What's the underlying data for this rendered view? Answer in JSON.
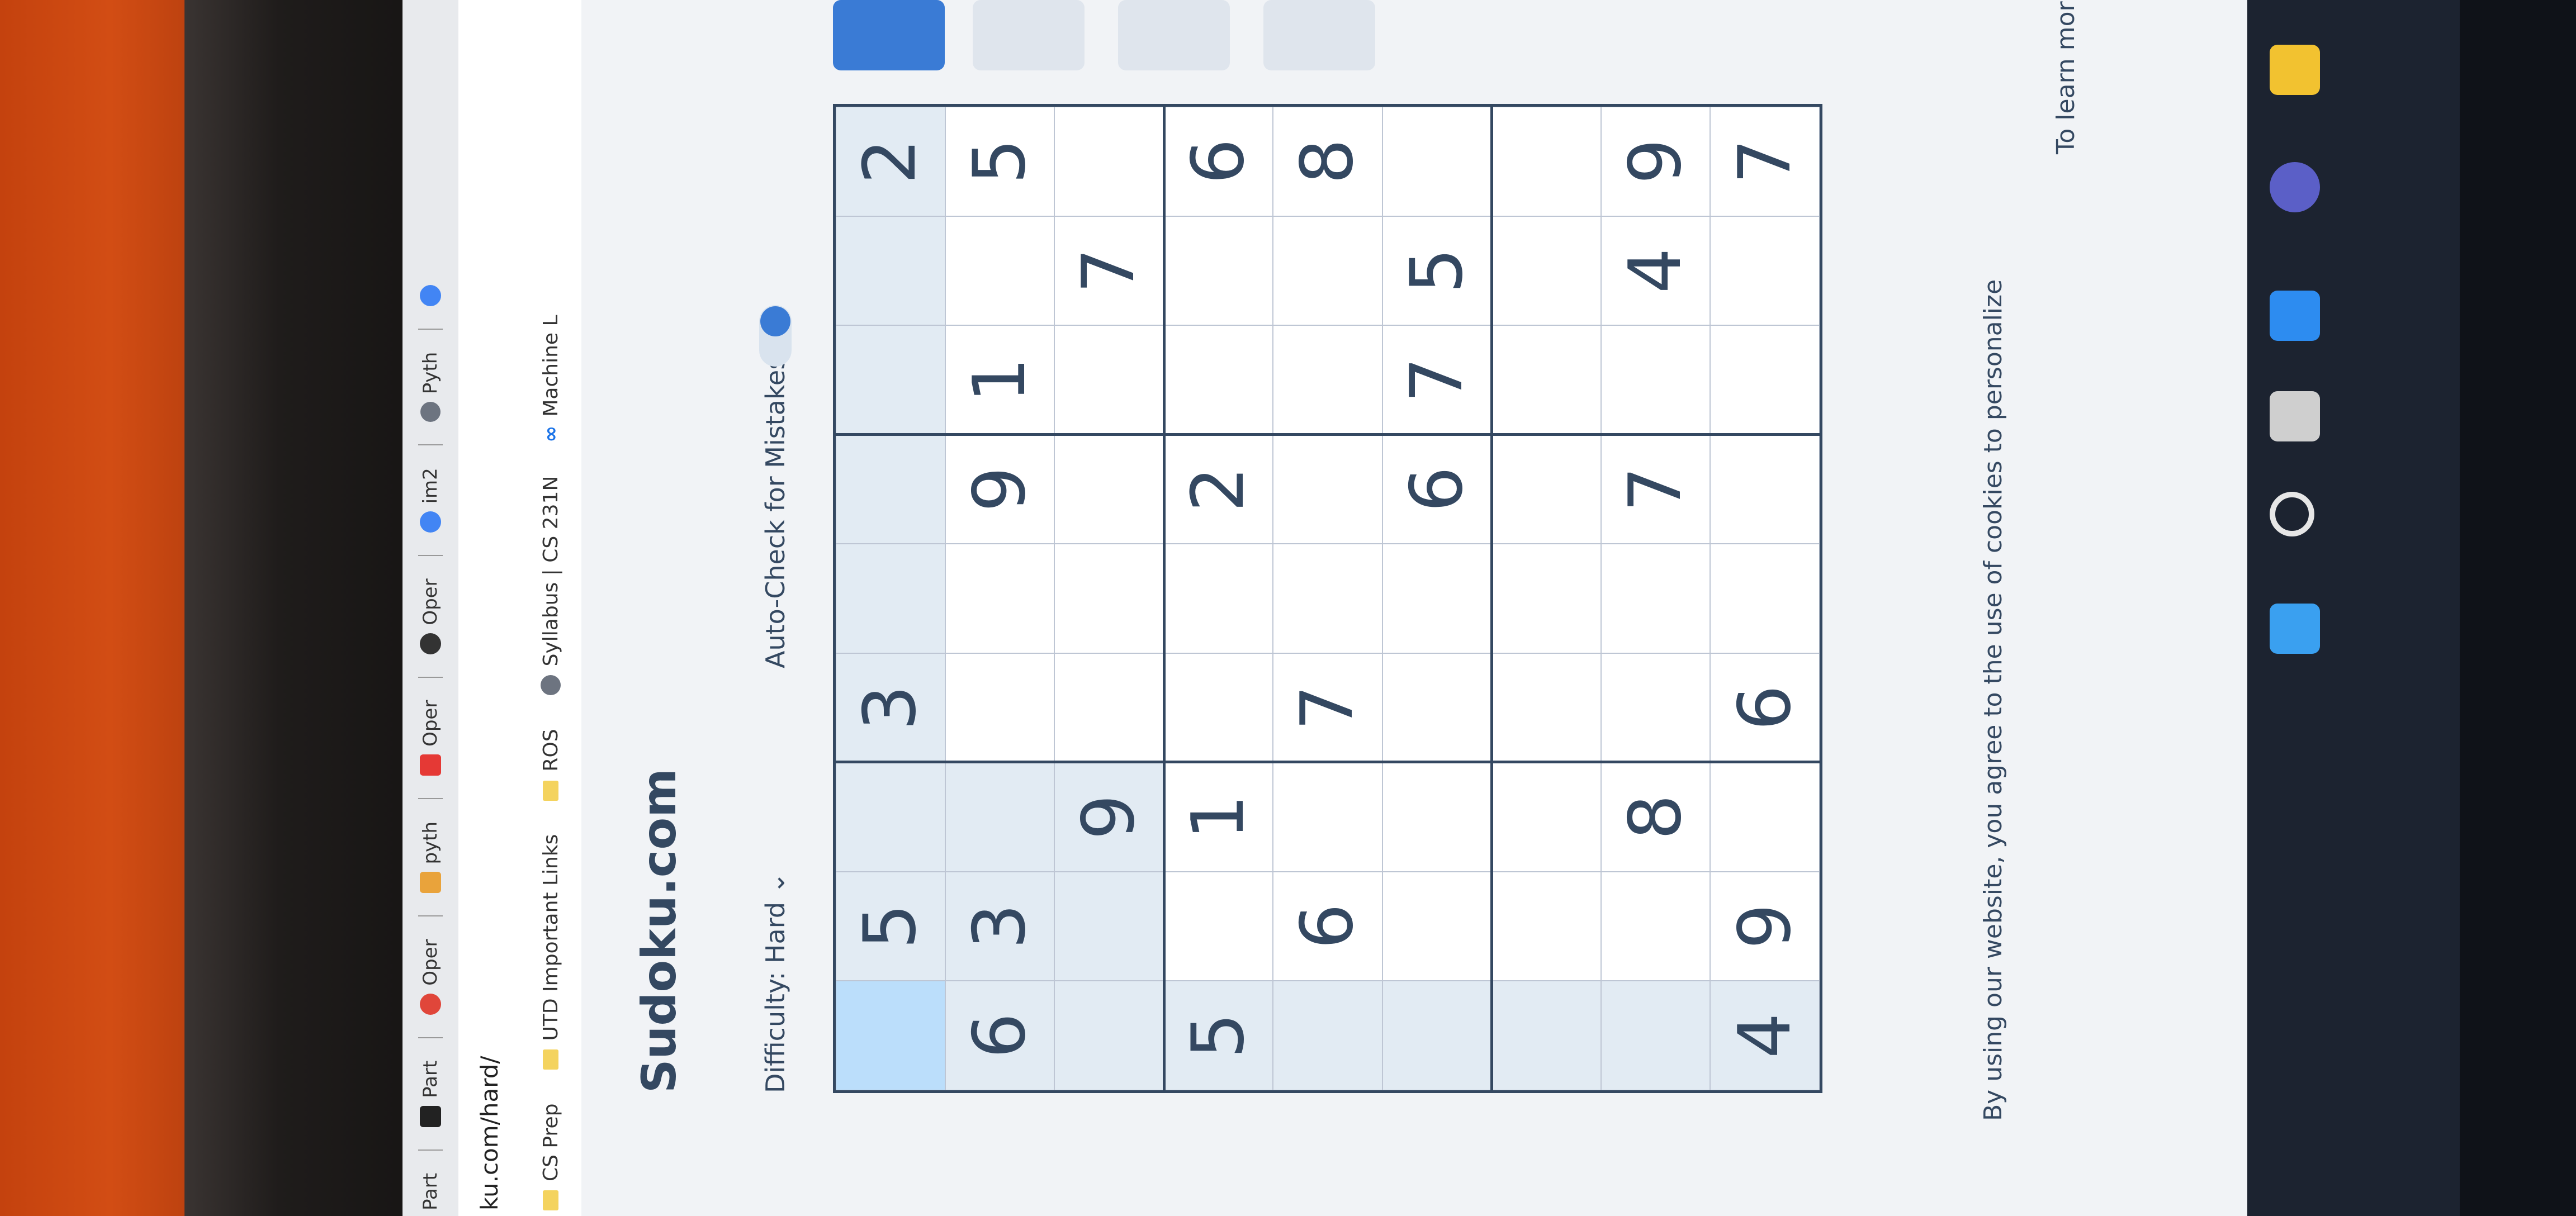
{
  "browser": {
    "tabs": [
      "Part",
      "Part",
      "Oper",
      "pyth",
      "Oper",
      "Oper",
      "im2",
      "Pyth"
    ],
    "url": "ku.com/hard/",
    "bookmarks": [
      "CS Prep",
      "UTD Important Links",
      "ROS",
      "Syllabus | CS 231N",
      "Machine L"
    ]
  },
  "page": {
    "logo": "Sudoku.com",
    "difficulty_label": "Difficulty:",
    "difficulty_value": "Hard",
    "autocheck_label": "Auto-Check for Mistakes",
    "cookie_line1": "By using our website, you agree to the use of cookies to personalize",
    "cookie_line2": "To learn mor"
  },
  "grid": [
    [
      "",
      "5",
      "",
      "3",
      "",
      "",
      "",
      "",
      "2"
    ],
    [
      "6",
      "3",
      "",
      "",
      "",
      "9",
      "1",
      "",
      "5"
    ],
    [
      "",
      "",
      "9",
      "",
      "",
      "",
      "",
      "7",
      ""
    ],
    [
      "5",
      "",
      "1",
      "",
      "",
      "2",
      "",
      "",
      "6"
    ],
    [
      "",
      "6",
      "",
      "7",
      "",
      "",
      "",
      "",
      "8"
    ],
    [
      "",
      "",
      "",
      "",
      "",
      "6",
      "7",
      "5",
      ""
    ],
    [
      "",
      "",
      "",
      "",
      "",
      "",
      "",
      "",
      ""
    ],
    [
      "",
      "",
      "8",
      "",
      "",
      "7",
      "",
      "4",
      "9"
    ],
    [
      "4",
      "9",
      "",
      "6",
      "",
      "",
      "",
      "",
      "7"
    ]
  ],
  "colors": {
    "digit": "#344861",
    "selected_cell": "#bbdefb",
    "highlight": "#e2ebf3",
    "desk": "#d24d14"
  }
}
